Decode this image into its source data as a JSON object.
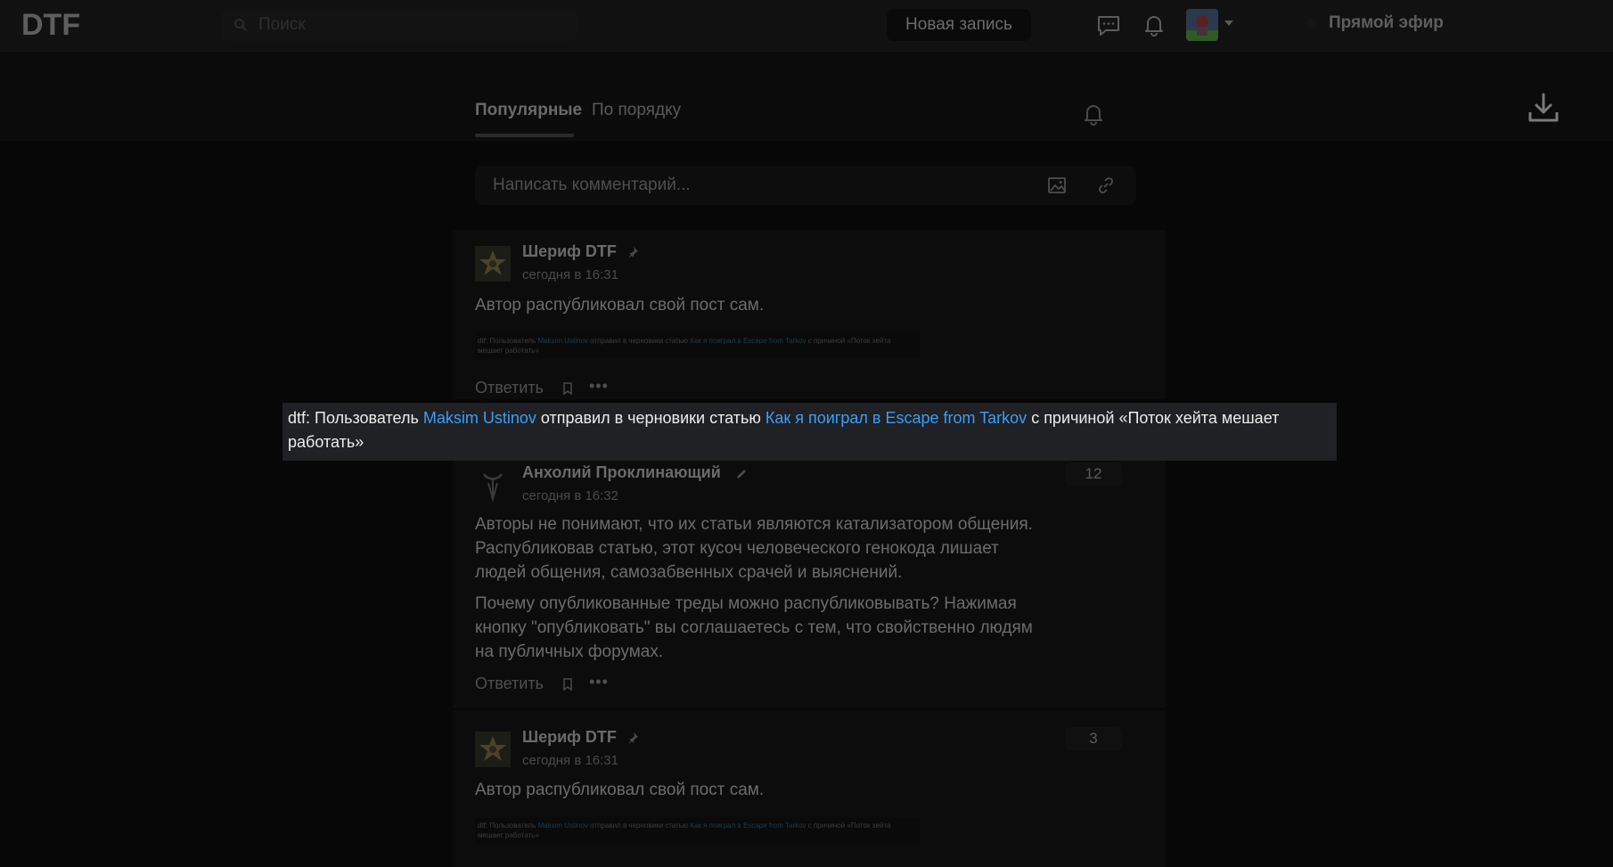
{
  "header": {
    "logo": "DTF",
    "search_placeholder": "Поиск",
    "new_post": "Новая запись",
    "live": "Прямой эфир"
  },
  "subheader": {
    "tabs": [
      "Популярные",
      "По порядку"
    ],
    "active_tab": "Популярные"
  },
  "composer": {
    "placeholder": "Написать комментарий..."
  },
  "tooltip": {
    "prefix": "dtf: Пользователь ",
    "user": "Maksim Ustinov",
    "mid": " отправил в черновики статью ",
    "article": "Как я поиграл в Escape from Tarkov",
    "suffix": " с причиной «Поток хейта мешает работать»"
  },
  "comments": [
    {
      "author": "Шериф DTF",
      "date": "сегодня в 16:31",
      "text": "Автор распубликовал свой пост сам.",
      "thumb_prefix": "dtf: Пользователь ",
      "thumb_user": "Maksim Ustinov",
      "thumb_mid": " отправил в черновики статью ",
      "thumb_article": "Как я поиграл в Escape from Tarkov",
      "thumb_suffix": " с причиной «Поток хейта мешает работать»",
      "reply": "Ответить"
    },
    {
      "author": "Анхолий Проклинающий",
      "date": "сегодня в 16:32",
      "votes": "12",
      "paragraphs": [
        "Авторы не понимают, что их статьи являются катализатором общения. Распубликовав статью, этот кусоч человеческого генокода лишает людей общения, самозабвенных срачей и выяснений.",
        "Почему опубликованные треды можно распубликовывать? Нажимая кнопку \"опубликовать\" вы соглашаетесь с тем, что свойственно людям на публичных форумах."
      ],
      "reply": "Ответить"
    },
    {
      "author": "Шериф DTF",
      "date": "сегодня в 16:31",
      "votes": "3",
      "text": "Автор распубликовал свой пост сам.",
      "thumb_prefix": "dtf: Пользователь ",
      "thumb_user": "Maksim Ustinov",
      "thumb_mid": " отправил в черновики статью ",
      "thumb_article": "Как я поиграл в Escape from Tarkov",
      "thumb_suffix": " с причиной «Поток хейта мешает работать»"
    }
  ],
  "dots": "•••",
  "icons": [
    "search-icon",
    "messages-icon",
    "bell-icon",
    "chevron-down-icon",
    "download-icon",
    "image-icon",
    "link-icon",
    "pin-icon",
    "pencil-icon",
    "bookmark-icon",
    "more-icon"
  ]
}
